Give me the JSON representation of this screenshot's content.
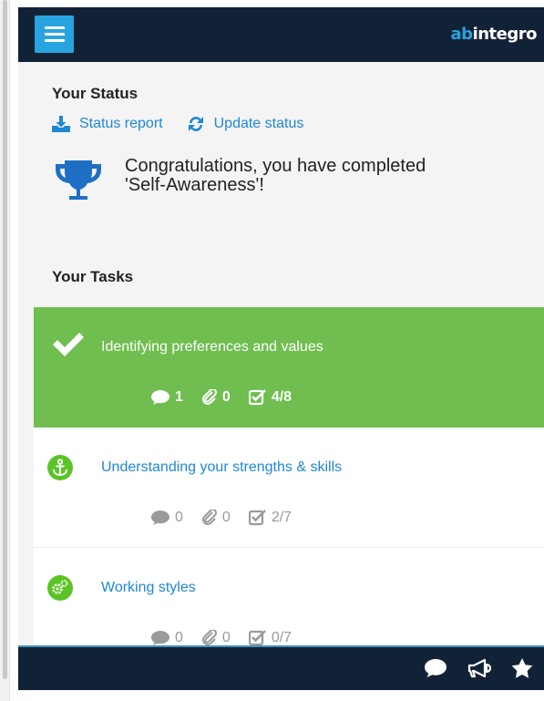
{
  "header": {
    "brand_part1": "ab",
    "brand_part2": "integro",
    "menu_icon": "hamburger-menu-icon",
    "colors": {
      "bar": "#122236",
      "menu_button": "#27a4e0"
    }
  },
  "status": {
    "heading": "Your Status",
    "report_link": "Status report",
    "update_link": "Update status",
    "congrats_line1": "Congratulations, you have completed",
    "congrats_line2": "'Self-Awareness'!",
    "icons": [
      "download-icon",
      "refresh-icon",
      "trophy-icon"
    ]
  },
  "tasks": {
    "heading": "Your Tasks",
    "items": [
      {
        "title": "Identifying preferences and values",
        "state": "completed",
        "icon": "check-icon",
        "comments": "1",
        "attachments": "0",
        "checklist": "4/8"
      },
      {
        "title": "Understanding your strengths & skills",
        "state": "in-progress",
        "icon": "anchor-icon",
        "comments": "0",
        "attachments": "0",
        "checklist": "2/7"
      },
      {
        "title": "Working styles",
        "state": "in-progress",
        "icon": "gears-icon",
        "comments": "0",
        "attachments": "0",
        "checklist": "0/7"
      }
    ],
    "colors": {
      "completed": "#6fbe4f",
      "link": "#1e88d3",
      "icon_circle": "#5ac426"
    }
  },
  "footer": {
    "icons": [
      "chat-icon",
      "megaphone-icon",
      "star-icon"
    ]
  }
}
